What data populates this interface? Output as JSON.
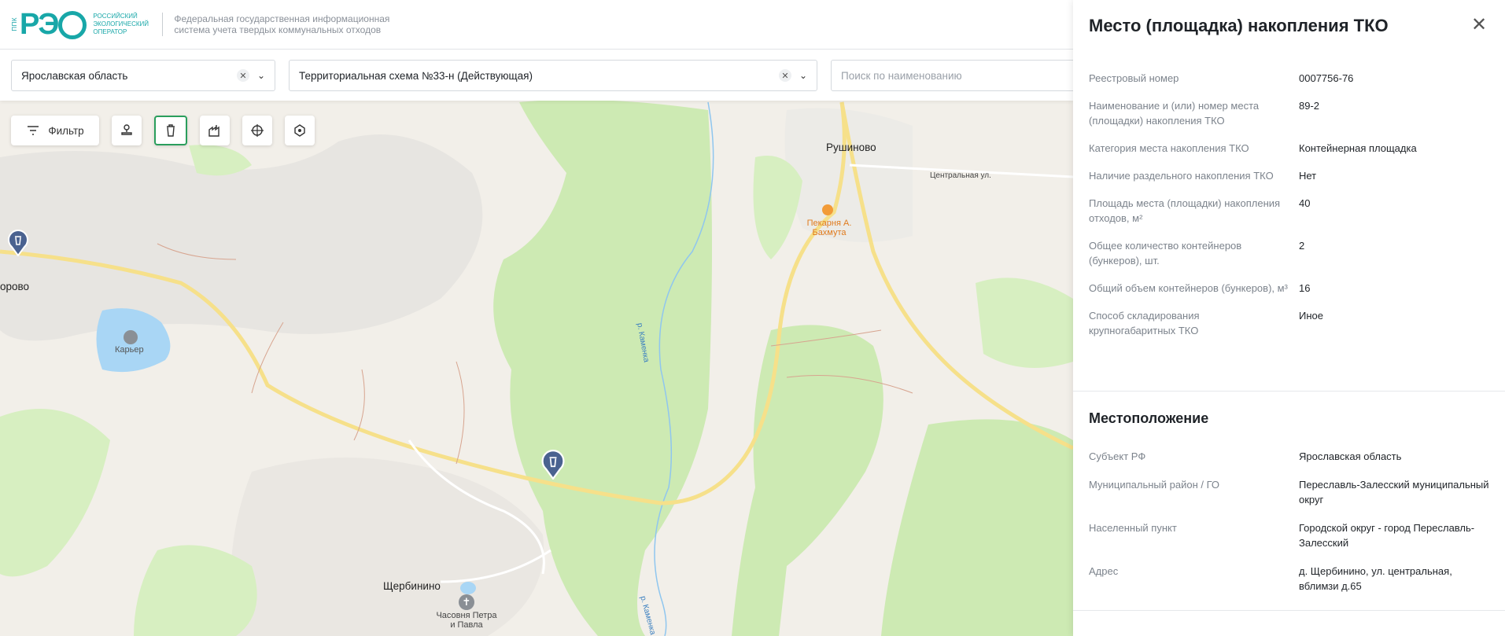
{
  "header": {
    "logo_prefix": "ППК",
    "logo_mark": "РЭ",
    "logo_text": "Российский экологический оператор",
    "title": "Федеральная государственная информационная система учета твердых коммунальных отходов"
  },
  "filters": {
    "region": "Ярославская область",
    "scheme": "Территориальная схема №33-н (Действующая)",
    "search_placeholder": "Поиск по наименованию"
  },
  "tools": {
    "filter_label": "Фильтр",
    "items": [
      "stamp-icon",
      "trash-bin-icon",
      "factory-icon",
      "crosshair-icon",
      "polygon-icon"
    ]
  },
  "map_labels": {
    "rushinovo": "Рушиново",
    "street": "Центральная ул.",
    "bakery": "Пекарня А. Бахмута",
    "karer": "Карьер",
    "orovo": "орово",
    "river1": "р. Каменка",
    "river2": "р. Каменка",
    "shcherbinino": "Щербинино",
    "chapel": "Часовня Петра и Павла"
  },
  "panel": {
    "title": "Место (площадка) накопления ТКО",
    "details": [
      {
        "label": "Реестровый номер",
        "value": "0007756-76"
      },
      {
        "label": "Наименование и (или) номер места (площадки) накопления ТКО",
        "value": "89-2"
      },
      {
        "label": "Категория места накопления ТКО",
        "value": "Контейнерная площадка"
      },
      {
        "label": "Наличие раздельного накопления ТКО",
        "value": "Нет"
      },
      {
        "label": "Площадь места (площадки) накопления отходов, м²",
        "value": "40"
      },
      {
        "label": "Общее количество контейнеров (бункеров), шт.",
        "value": "2"
      },
      {
        "label": "Общий объем контейнеров (бункеров), м³",
        "value": "16"
      },
      {
        "label": "Способ складирования крупногабаритных ТКО",
        "value": "Иное"
      }
    ],
    "location_title": "Местоположение",
    "location": [
      {
        "label": "Субъект РФ",
        "value": "Ярославская область"
      },
      {
        "label": "Муниципальный район / ГО",
        "value": "Переславль-Залесский муниципальный округ"
      },
      {
        "label": "Населенный пункт",
        "value": "Городской округ - город Переславль-Залесский"
      },
      {
        "label": "Адрес",
        "value": "д. Щербинино, ул. центральная, вблимзи д.65"
      }
    ]
  },
  "colors": {
    "accent": "#2a9e5c",
    "brand": "#18a7a8",
    "forest": "#cdeab3",
    "road": "#f6e08a",
    "water": "#a9d6f5",
    "marker": "#4a6290"
  }
}
